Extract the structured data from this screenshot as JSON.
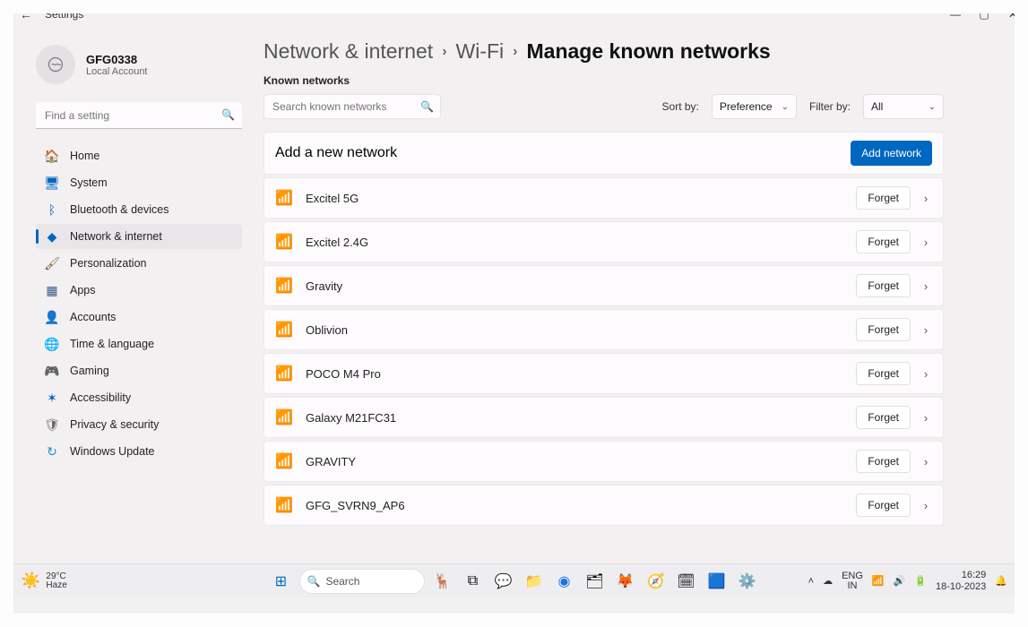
{
  "window": {
    "title": "Settings"
  },
  "profile": {
    "name": "GFG0338",
    "sub": "Local Account"
  },
  "search": {
    "placeholder": "Find a setting"
  },
  "nav": [
    {
      "key": "home",
      "label": "Home",
      "icon": "🏠",
      "color": "#c97a1d"
    },
    {
      "key": "system",
      "label": "System",
      "icon": "🖥",
      "color": "#0067c0"
    },
    {
      "key": "bluetooth",
      "label": "Bluetooth & devices",
      "icon": "ᛒ",
      "color": "#0067c0"
    },
    {
      "key": "network",
      "label": "Network & internet",
      "icon": "◆",
      "color": "#0067c0",
      "active": true
    },
    {
      "key": "personalization",
      "label": "Personalization",
      "icon": "🖌",
      "color": "#7a5c2e"
    },
    {
      "key": "apps",
      "label": "Apps",
      "icon": "▦",
      "color": "#355a8a"
    },
    {
      "key": "accounts",
      "label": "Accounts",
      "icon": "👤",
      "color": "#0067c0"
    },
    {
      "key": "time",
      "label": "Time & language",
      "icon": "🌐",
      "color": "#2f6fb0"
    },
    {
      "key": "gaming",
      "label": "Gaming",
      "icon": "🎮",
      "color": "#6a6a6a"
    },
    {
      "key": "accessibility",
      "label": "Accessibility",
      "icon": "✶",
      "color": "#0067c0"
    },
    {
      "key": "privacy",
      "label": "Privacy & security",
      "icon": "🛡",
      "color": "#6a6a6a"
    },
    {
      "key": "update",
      "label": "Windows Update",
      "icon": "↻",
      "color": "#1f8fd6"
    }
  ],
  "breadcrumb": {
    "root": "Network & internet",
    "mid": "Wi-Fi",
    "leaf": "Manage known networks"
  },
  "section": {
    "label": "Known networks"
  },
  "net_search": {
    "placeholder": "Search known networks"
  },
  "sort": {
    "label": "Sort by:",
    "value": "Preference"
  },
  "filter": {
    "label": "Filter by:",
    "value": "All"
  },
  "addrow": {
    "label": "Add a new network",
    "button": "Add network"
  },
  "networks": [
    {
      "name": "Excitel 5G"
    },
    {
      "name": "Excitel 2.4G"
    },
    {
      "name": "Gravity"
    },
    {
      "name": "Oblivion"
    },
    {
      "name": "POCO M4 Pro"
    },
    {
      "name": "Galaxy M21FC31"
    },
    {
      "name": "GRAVITY"
    },
    {
      "name": "GFG_SVRN9_AP6"
    }
  ],
  "forget_label": "Forget",
  "taskbar": {
    "weather_temp": "29°C",
    "weather_desc": "Haze",
    "search_label": "Search",
    "lang1": "ENG",
    "lang2": "IN",
    "time": "16:29",
    "date": "18-10-2023"
  }
}
